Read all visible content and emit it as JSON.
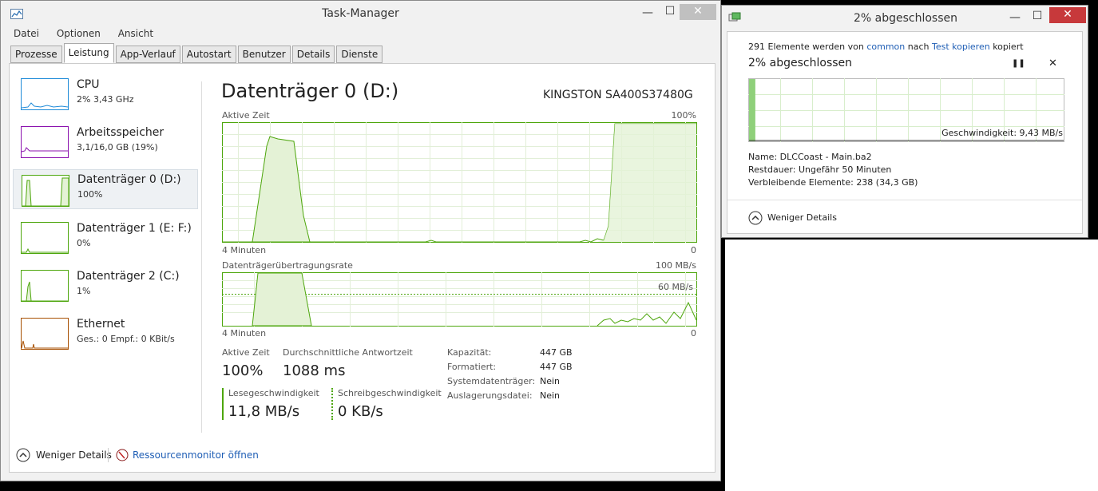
{
  "taskmanager": {
    "title": "Task-Manager",
    "min": "—",
    "max": "☐",
    "close": "✕",
    "menu": [
      "Datei",
      "Optionen",
      "Ansicht"
    ],
    "tabs": [
      "Prozesse",
      "Leistung",
      "App-Verlauf",
      "Autostart",
      "Benutzer",
      "Details",
      "Dienste"
    ],
    "sidebar": [
      {
        "title": "CPU",
        "sub": "2% 3,43 GHz",
        "color": "#1f8bd8"
      },
      {
        "title": "Arbeitsspeicher",
        "sub": "3,1/16,0 GB (19%)",
        "color": "#8b12ae"
      },
      {
        "title": "Datenträger 0 (D:)",
        "sub": "100%",
        "color": "#4da60c"
      },
      {
        "title": "Datenträger 1 (E: F:)",
        "sub": "0%",
        "color": "#4da60c"
      },
      {
        "title": "Datenträger 2 (C:)",
        "sub": "1%",
        "color": "#4da60c"
      },
      {
        "title": "Ethernet",
        "sub": "Ges.: 0 Empf.: 0 KBit/s",
        "color": "#a74f01"
      }
    ],
    "panel": {
      "title": "Datenträger 0 (D:)",
      "model": "KINGSTON SA400S37480G",
      "chart1_label": "Aktive Zeit",
      "chart1_max": "100%",
      "chart1_left": "4 Minuten",
      "chart1_right": "0",
      "chart2_label": "Datenträgerübertragungsrate",
      "chart2_max": "100 MB/s",
      "chart2_mid": "60 MB/s",
      "chart2_left": "4 Minuten",
      "chart2_right": "0",
      "active_time_label": "Aktive Zeit",
      "active_time_value": "100%",
      "response_label": "Durchschnittliche Antwortzeit",
      "response_value": "1088 ms",
      "read_label": "Lesegeschwindigkeit",
      "read_value": "11,8 MB/s",
      "write_label": "Schreibgeschwindigkeit",
      "write_value": "0 KB/s",
      "props": [
        {
          "k": "Kapazität:",
          "v": "447 GB"
        },
        {
          "k": "Formatiert:",
          "v": "447 GB"
        },
        {
          "k": "Systemdatenträger:",
          "v": "Nein"
        },
        {
          "k": "Auslagerungsdatei:",
          "v": "Nein"
        }
      ]
    },
    "footer": {
      "less": "Weniger Details",
      "resmon": "Ressourcenmonitor öffnen"
    }
  },
  "copy": {
    "title": "2% abgeschlossen",
    "min": "—",
    "max": "☐",
    "close": "✕",
    "line_pre": "291 Elemente werden von",
    "from": "common",
    "line_mid": "nach",
    "to": "Test kopieren",
    "line_post": "kopiert",
    "progress_title": "2% abgeschlossen",
    "progress": 0.02,
    "pause": "❚❚",
    "cancel": "✕",
    "speed": "Geschwindigkeit: 9,43 MB/s",
    "name_label": "Name:",
    "name_value": "DLCCoast - Main.ba2",
    "rest_label": "Restdauer:",
    "rest_value": "Ungefähr 50 Minuten",
    "remain_label": "Verbleibende Elemente:",
    "remain_value": "238 (34,3 GB)",
    "less": "Weniger Details"
  }
}
